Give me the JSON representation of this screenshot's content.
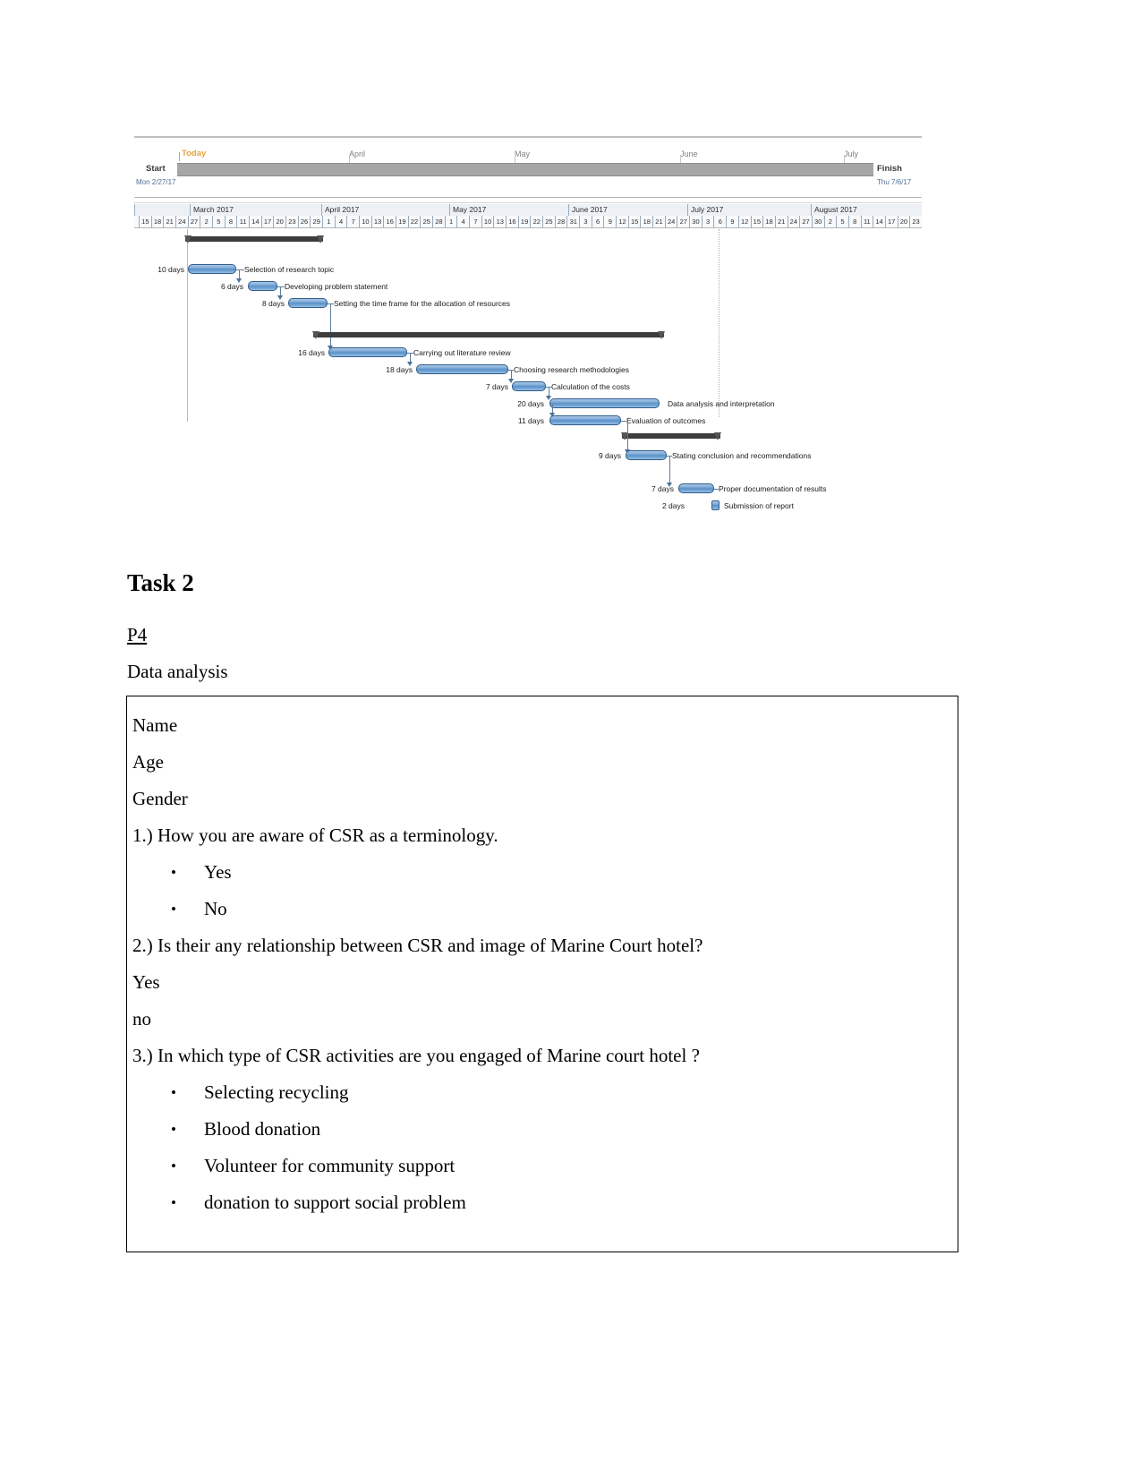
{
  "gantt": {
    "today_label": "Today",
    "start_label": "Start",
    "start_date": "Mon 2/27/17",
    "finish_label": "Finish",
    "finish_date": "Thu 7/6/17",
    "timeline_months": [
      "April",
      "May",
      "June",
      "July"
    ],
    "header_months": [
      "March 2017",
      "April 2017",
      "May 2017",
      "June 2017",
      "July 2017",
      "August 2017"
    ],
    "header_days": [
      "15",
      "18",
      "21",
      "24",
      "27",
      "2",
      "5",
      "8",
      "11",
      "14",
      "17",
      "20",
      "23",
      "26",
      "29",
      "1",
      "4",
      "7",
      "10",
      "13",
      "16",
      "19",
      "22",
      "25",
      "28",
      "1",
      "4",
      "7",
      "10",
      "13",
      "16",
      "19",
      "22",
      "25",
      "28",
      "31",
      "3",
      "6",
      "9",
      "12",
      "15",
      "18",
      "21",
      "24",
      "27",
      "30",
      "3",
      "6",
      "9",
      "12",
      "15",
      "18",
      "21",
      "24",
      "27",
      "30",
      "2",
      "5",
      "8",
      "11",
      "14",
      "17",
      "20",
      "23"
    ],
    "tasks": [
      {
        "duration": "10 days",
        "name": "Selection of research topic"
      },
      {
        "duration": "6 days",
        "name": "Developing problem statement"
      },
      {
        "duration": "8 days",
        "name": "Setting the time frame for the allocation of resources"
      },
      {
        "duration": "16 days",
        "name": "Carrying out literature review"
      },
      {
        "duration": "18 days",
        "name": "Choosing research methodologies"
      },
      {
        "duration": "7 days",
        "name": "Calculation of the costs"
      },
      {
        "duration": "20 days",
        "name": "Data analysis and interpretation"
      },
      {
        "duration": "11 days",
        "name": "Evaluation of outcomes"
      },
      {
        "duration": "9 days",
        "name": "Stating conclusion and recommendations"
      },
      {
        "duration": "7 days",
        "name": "Proper documentation of results"
      },
      {
        "duration": "2 days",
        "name": "Submission of report"
      }
    ]
  },
  "document": {
    "heading": "Task 2",
    "subheading": "P4 ",
    "section_label": "Data analysis",
    "questionnaire": {
      "fields": [
        "Name",
        "Age",
        "Gender"
      ],
      "q1": "1.) How you are aware of CSR as a terminology.",
      "q1_options": [
        "Yes",
        "No"
      ],
      "q2": "2.) Is their any relationship between CSR and image of Marine Court hotel?",
      "q2_options": [
        "Yes",
        "no"
      ],
      "q3": "3.) In which type of CSR activities are you engaged of Marine court hotel ?",
      "q3_options": [
        "Selecting recycling",
        "Blood donation",
        "Volunteer for community support",
        "donation to support social problem"
      ]
    }
  }
}
